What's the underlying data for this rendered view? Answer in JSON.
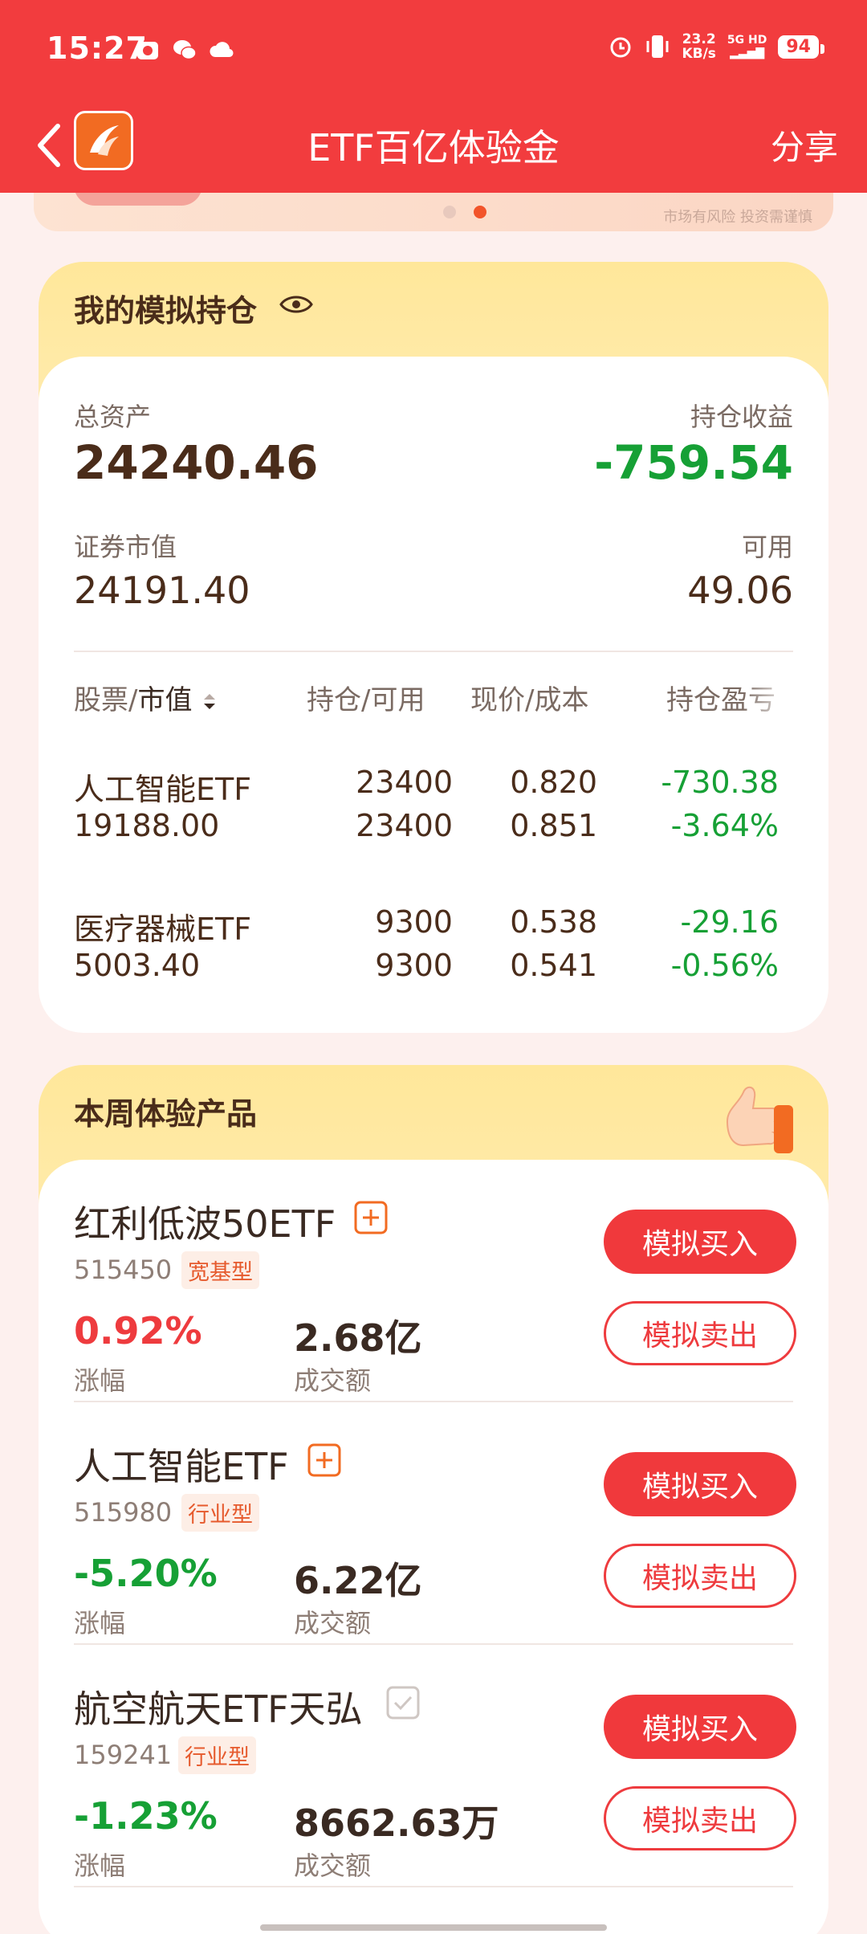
{
  "status_bar": {
    "time": "15:27",
    "net_speed": "23.2",
    "net_unit": "KB/s",
    "network": "5G HD",
    "battery": "94"
  },
  "nav": {
    "title": "ETF百亿体验金",
    "share": "分享"
  },
  "banner": {
    "disclaimer": "市场有风险 投资需谨慎"
  },
  "holdings": {
    "title": "我的模拟持仓",
    "total_assets_label": "总资产",
    "total_assets": "24240.46",
    "profit_label": "持仓收益",
    "profit": "-759.54",
    "market_value_label": "证券市值",
    "market_value": "24191.40",
    "available_label": "可用",
    "available": "49.06",
    "columns": [
      "股票/",
      "市值",
      "持仓/可用",
      "现价/成本",
      "持仓盈亏"
    ],
    "rows": [
      {
        "name": "人工智能ETF",
        "value": "19188.00",
        "hold": "23400",
        "avail": "23400",
        "price": "0.820",
        "cost": "0.851",
        "pnl": "-730.38",
        "pnl_pct": "-3.64%"
      },
      {
        "name": "医疗器械ETF",
        "value": "5003.40",
        "hold": "9300",
        "avail": "9300",
        "price": "0.538",
        "cost": "0.541",
        "pnl": "-29.16",
        "pnl_pct": "-0.56%"
      }
    ]
  },
  "products": {
    "title": "本周体验产品",
    "change_label": "涨幅",
    "volume_label": "成交额",
    "buy_label": "模拟买入",
    "sell_label": "模拟卖出",
    "items": [
      {
        "name": "红利低波50ETF",
        "code": "515450",
        "tag": "宽基型",
        "change": "0.92%",
        "volume": "2.68亿",
        "added": false
      },
      {
        "name": "人工智能ETF",
        "code": "515980",
        "tag": "行业型",
        "change": "-5.20%",
        "volume": "6.22亿",
        "added": false
      },
      {
        "name": "航空航天ETF天弘",
        "code": "159241",
        "tag": "行业型",
        "change": "-1.23%",
        "volume": "8662.63万",
        "added": true
      }
    ]
  }
}
